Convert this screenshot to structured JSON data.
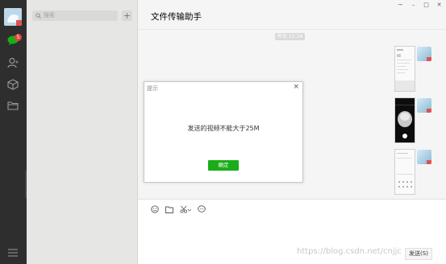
{
  "nav": {
    "badge_count": "5"
  },
  "search": {
    "placeholder": "搜索"
  },
  "chat": {
    "title": "文件传输助手",
    "timestamp": "昨天 15:24"
  },
  "window": {
    "pin": "ᅮ",
    "minimize": "–",
    "maximize": "□",
    "close": "✕"
  },
  "dialog": {
    "title": "提示",
    "message": "发送的视频不能大于25M",
    "confirm": "确定",
    "close": "×"
  },
  "input": {
    "send": "发送(S)"
  },
  "watermark": "https://blog.csdn.net/cnjjc",
  "colors": {
    "accent": "#1aad19",
    "nav_bg": "#2e2e2e",
    "badge": "#e64340"
  }
}
